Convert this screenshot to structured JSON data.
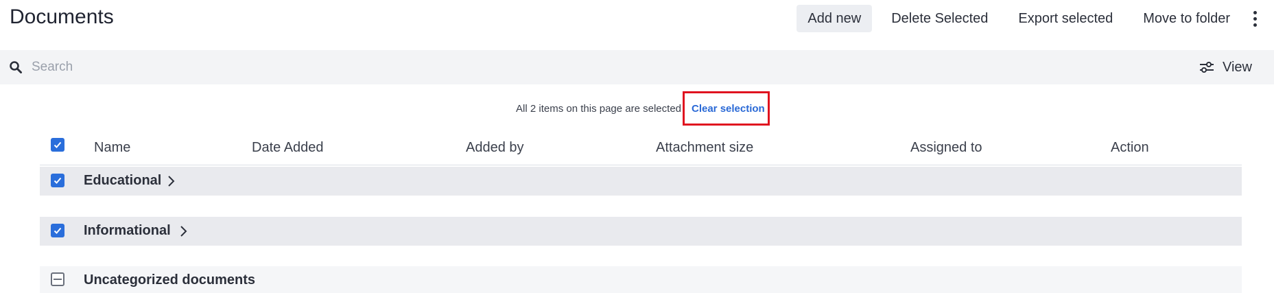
{
  "header": {
    "title": "Documents",
    "actions": {
      "add_new": "Add new",
      "delete_selected": "Delete Selected",
      "export_selected": "Export selected",
      "move_to_folder": "Move to folder"
    }
  },
  "search": {
    "placeholder": "Search",
    "value": "",
    "view_label": "View"
  },
  "selection": {
    "message": "All 2 items on this page are selected",
    "clear_label": "Clear selection"
  },
  "table": {
    "columns": [
      "Name",
      "Date Added",
      "Added by",
      "Attachment size",
      "Assigned to",
      "Action"
    ],
    "groups": [
      {
        "label": "Educational",
        "checked": true,
        "expandable": true
      },
      {
        "label": "Informational",
        "checked": true,
        "expandable": true
      },
      {
        "label": "Uncategorized documents",
        "checked": "partial",
        "expandable": false
      }
    ]
  },
  "colors": {
    "accent": "#2a6edb",
    "link": "#2a69d6",
    "highlight": "#e0121f"
  },
  "icons": {
    "search": "search-icon",
    "view": "sliders-icon",
    "more": "kebab-icon",
    "expand": "chevron-right-icon"
  }
}
